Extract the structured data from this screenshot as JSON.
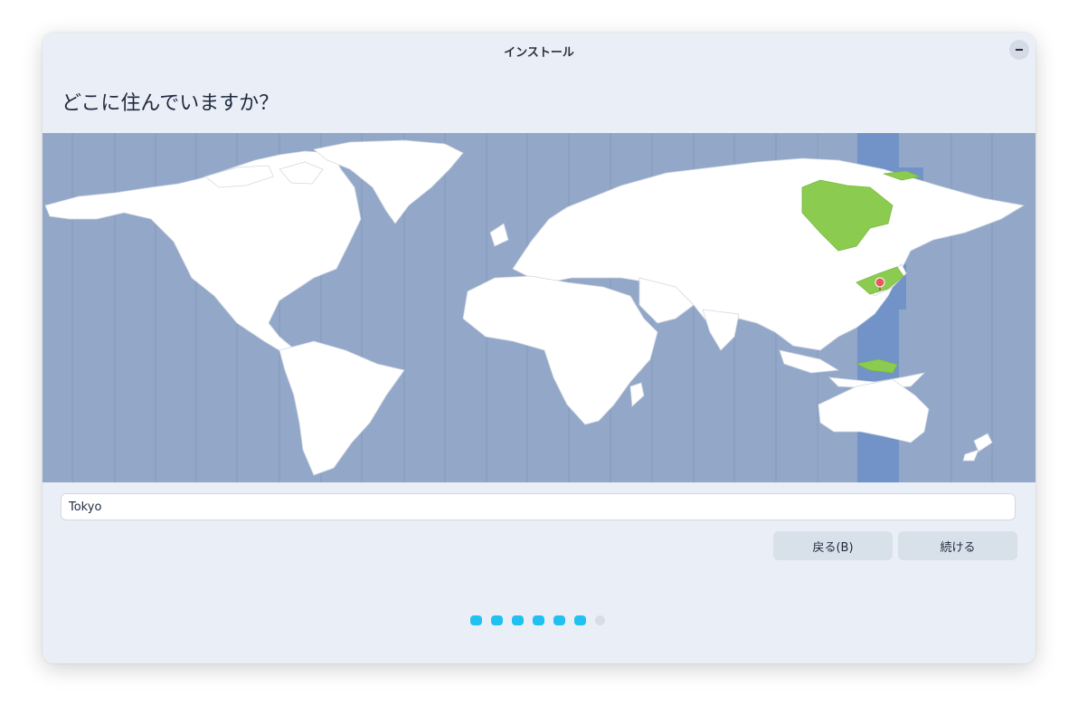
{
  "window": {
    "title": "インストール"
  },
  "page": {
    "heading": "どこに住んでいますか？"
  },
  "map": {
    "selected_timezone": "Asia/Tokyo",
    "selected_city": "Tokyo",
    "colors": {
      "ocean": "#93a8c8",
      "land": "#ffffff",
      "selected_band": "#7193c8",
      "selected_region": "#8bcc50",
      "pin": "#e8585a"
    }
  },
  "search": {
    "value": "Tokyo"
  },
  "buttons": {
    "back": "戻る(B)",
    "continue": "続ける"
  },
  "progress": {
    "total_steps": 7,
    "completed_steps": 6,
    "accent": "#20c0f0"
  }
}
